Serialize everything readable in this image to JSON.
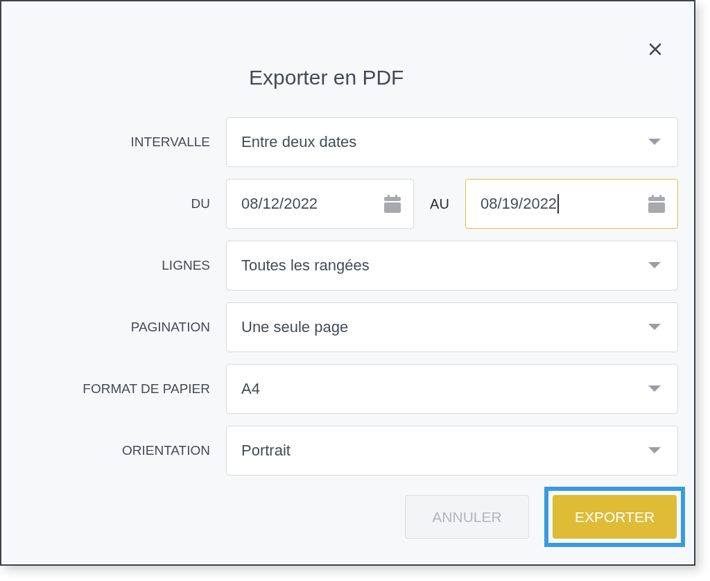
{
  "dialog": {
    "title": "Exporter en PDF"
  },
  "fields": [
    {
      "kind": "select",
      "label": "INTERVALLE",
      "value": "Entre deux dates"
    },
    {
      "kind": "daterange",
      "label": "DU",
      "from": {
        "value": "08/12/2022",
        "focused": false
      },
      "separator": "AU",
      "to": {
        "value": "08/19/2022",
        "focused": true
      }
    },
    {
      "kind": "select",
      "label": "LIGNES",
      "value": "Toutes les rangées"
    },
    {
      "kind": "select",
      "label": "PAGINATION",
      "value": "Une seule page"
    },
    {
      "kind": "select",
      "label": "FORMAT DE PAPIER",
      "value": "A4"
    },
    {
      "kind": "select",
      "label": "ORIENTATION",
      "value": "Portrait"
    }
  ],
  "buttons": [
    {
      "label": "ANNULER",
      "kind": "secondary",
      "disabled": true,
      "focused": false
    },
    {
      "label": "EXPORTER",
      "kind": "primary",
      "disabled": false,
      "focused": true
    }
  ]
}
